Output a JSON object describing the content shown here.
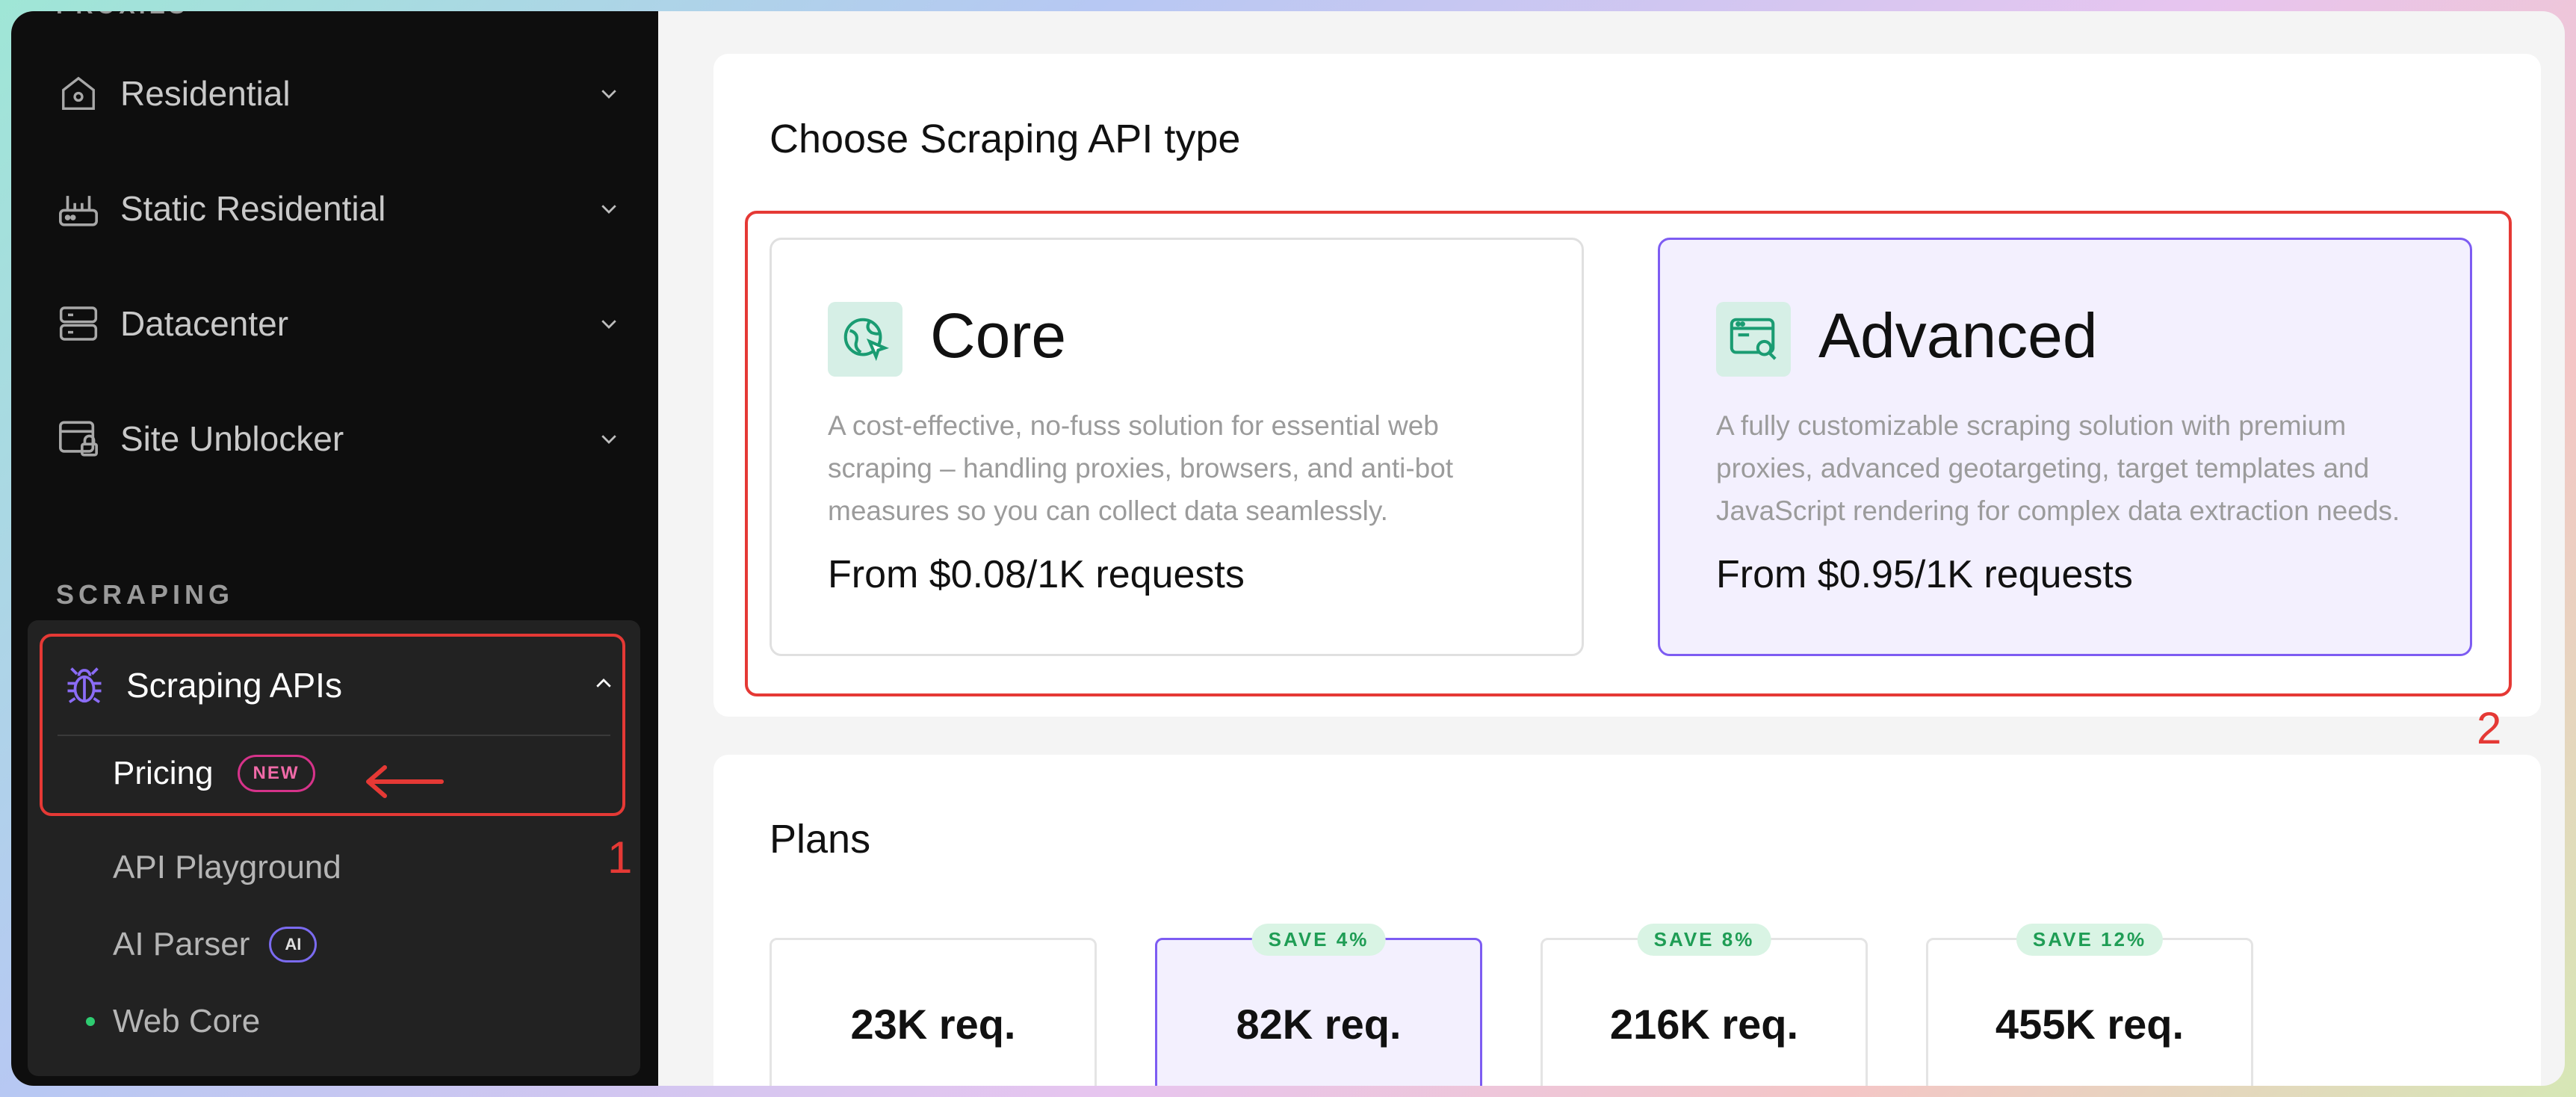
{
  "sidebar": {
    "section_top": "PROXIES",
    "items": [
      {
        "label": "Residential",
        "icon": "home-icon"
      },
      {
        "label": "Static Residential",
        "icon": "router-icon"
      },
      {
        "label": "Datacenter",
        "icon": "server-icon"
      },
      {
        "label": "Site Unblocker",
        "icon": "browser-lock-icon"
      }
    ],
    "section_scraping": "SCRAPING",
    "scraping_apis": {
      "label": "Scraping APIs",
      "icon": "bug-icon",
      "sub": [
        {
          "label": "Pricing",
          "badge": "NEW"
        },
        {
          "label": "API Playground"
        },
        {
          "label": "AI Parser",
          "badge": "AI"
        },
        {
          "label": "Web Core"
        }
      ]
    }
  },
  "annotations": {
    "one": "1",
    "two": "2"
  },
  "main": {
    "choose_title": "Choose Scraping API type",
    "types": [
      {
        "name": "Core",
        "description": "A cost-effective, no-fuss solution for essential web scraping – handling proxies, browsers, and anti-bot measures so you can collect data seamlessly.",
        "price": "From $0.08/1K requests",
        "icon": "globe-cursor-icon"
      },
      {
        "name": "Advanced",
        "description": "A fully customizable scraping solution with premium proxies, advanced geotargeting, target templates and JavaScript rendering for complex data extraction needs.",
        "price": "From $0.95/1K requests",
        "icon": "browser-search-icon"
      }
    ],
    "plans_title": "Plans",
    "plans": [
      {
        "req": "23K req.",
        "save": ""
      },
      {
        "req": "82K req.",
        "save": "SAVE 4%"
      },
      {
        "req": "216K req.",
        "save": "SAVE 8%"
      },
      {
        "req": "455K req.",
        "save": "SAVE 12%"
      }
    ]
  },
  "colors": {
    "accent": "#7d5cf2",
    "annotation_red": "#e53935",
    "save_green": "#1f9d55"
  }
}
